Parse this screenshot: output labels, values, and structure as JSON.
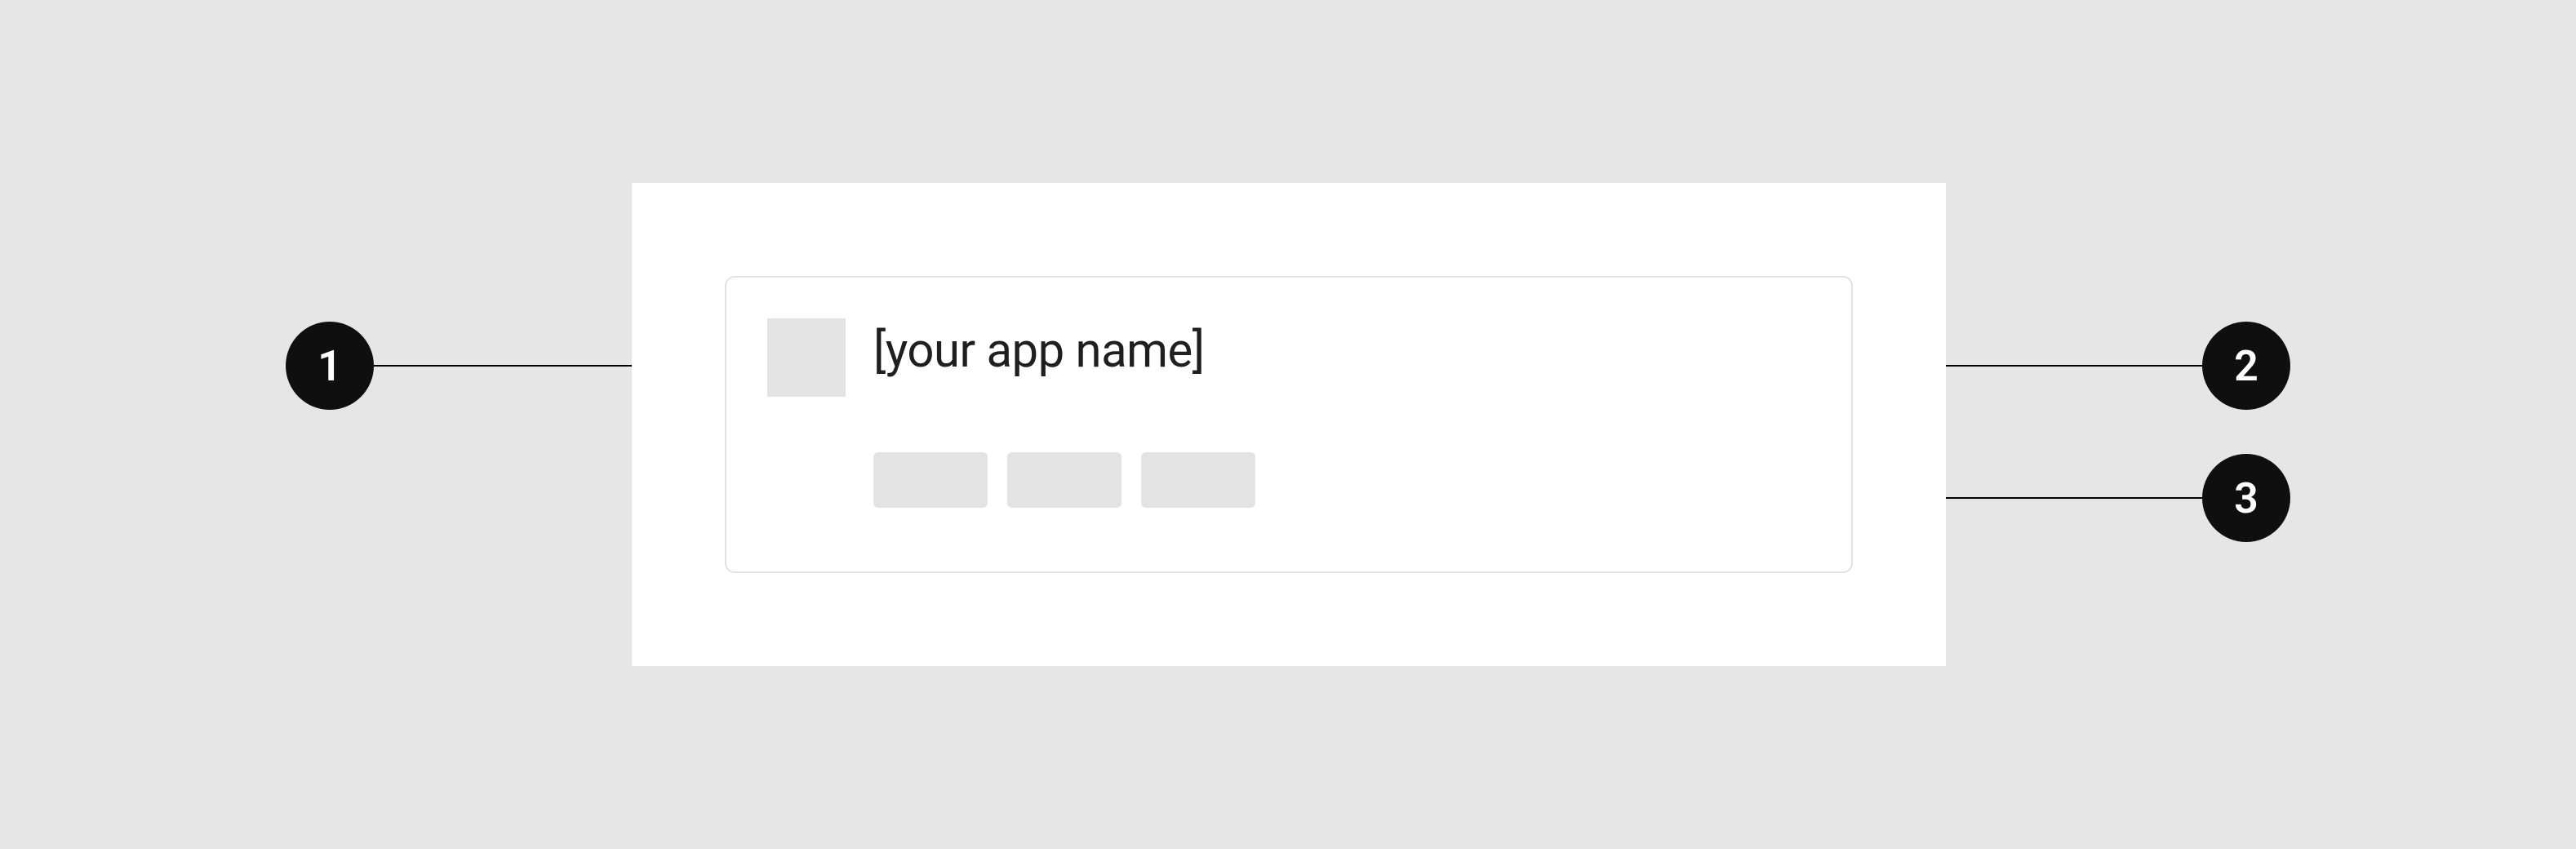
{
  "card": {
    "app_name": "[your app name]"
  },
  "callouts": {
    "badge1": "1",
    "badge2": "2",
    "badge3": "3"
  }
}
